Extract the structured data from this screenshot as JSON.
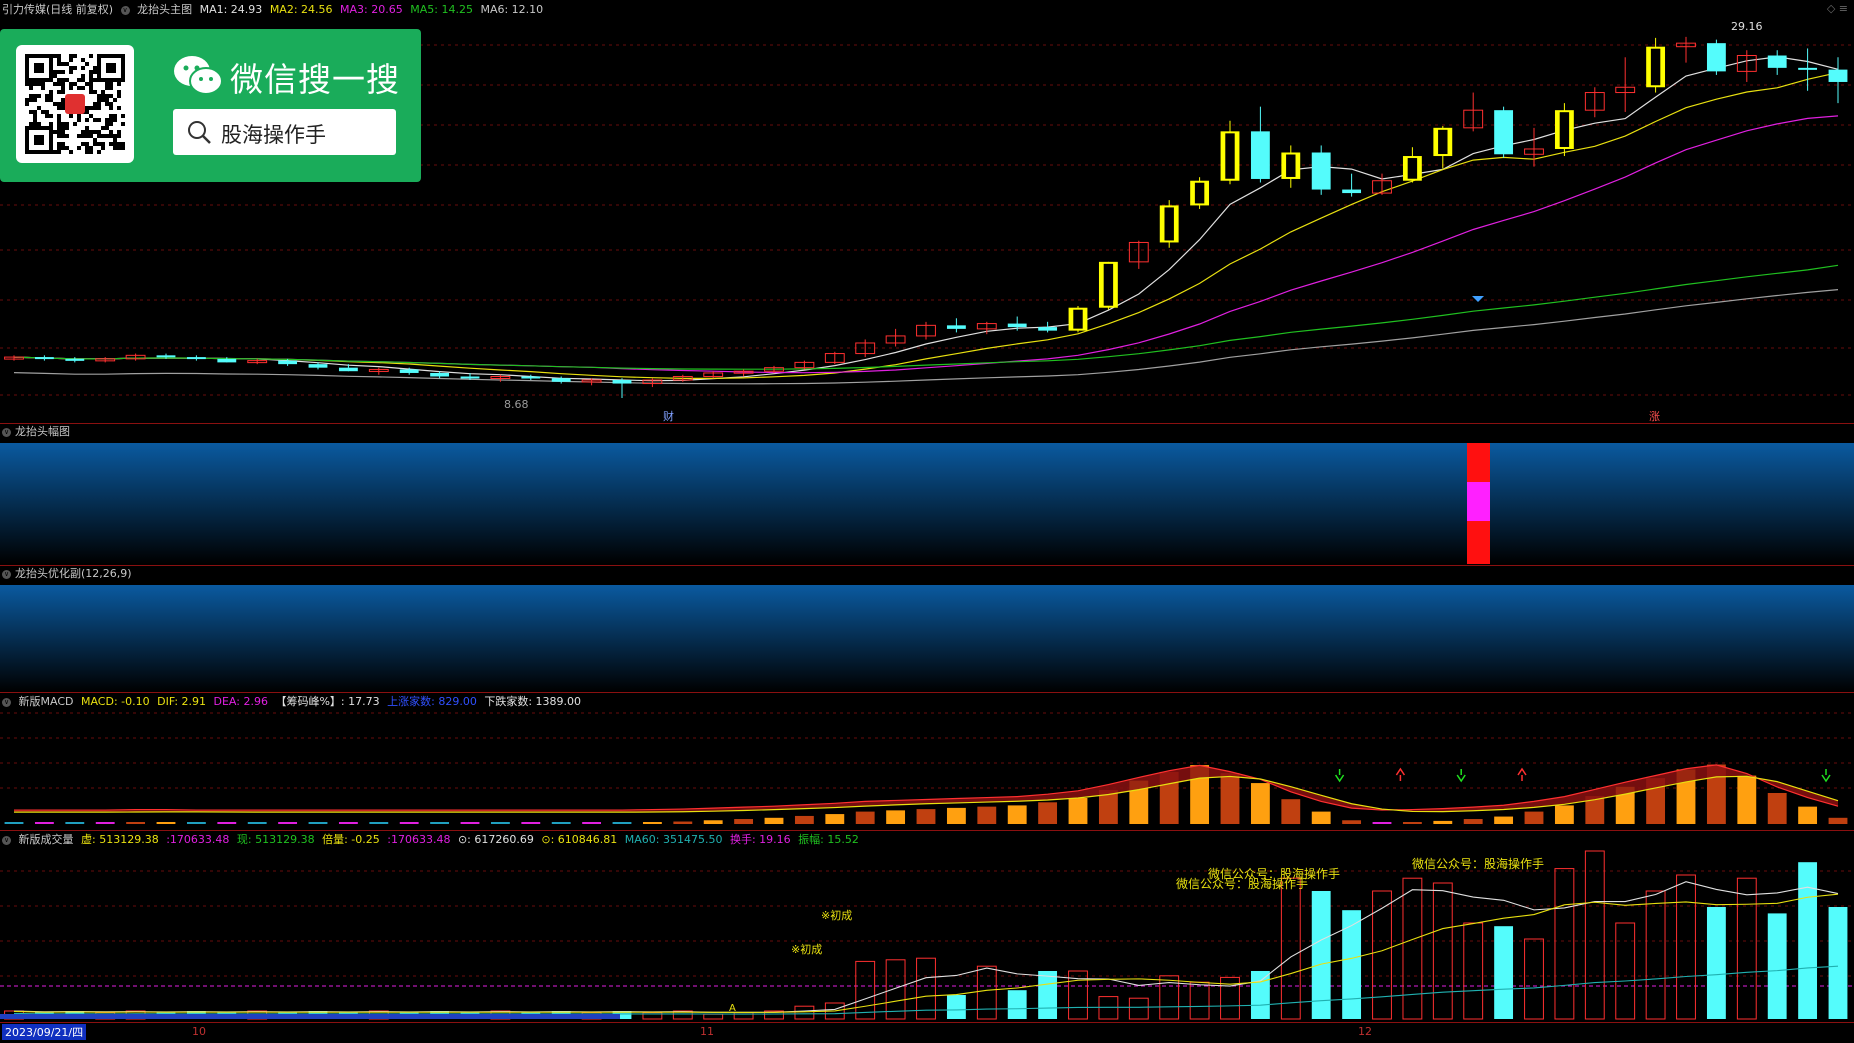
{
  "main_header": {
    "stock": "引力传媒(日线 前复权)",
    "indicator": "龙抬头主图",
    "ma1": "MA1: 24.93",
    "ma2": "MA2: 24.56",
    "ma3": "MA3: 20.65",
    "ma5": "MA5: 14.25",
    "ma6": "MA6: 12.10"
  },
  "main_annotations": {
    "high_price": "29.16",
    "low_price": "8.68",
    "marker_cai": "财",
    "marker_zhang": "涨"
  },
  "wechat_ad": {
    "title": "微信搜一搜",
    "search_text": "股海操作手"
  },
  "panel2_header": "龙抬头幅图",
  "panel3_header": "龙抬头优化副(12,26,9)",
  "macd_header": {
    "name": "新版MACD",
    "macd": "MACD: -0.10",
    "dif": "DIF: 2.91",
    "dea": "DEA: 2.96",
    "chip": "【筹码峰%】: 17.73",
    "up_count": "上涨家数: 829.00",
    "down_count": "下跌家数: 1389.00"
  },
  "volume_header": {
    "name": "新版成交量",
    "xu": "虚: 513129.38",
    "xu2": ":170633.48",
    "xian": "现: 513129.38",
    "beiliang": "倍量: -0.25",
    "beiliang2": ":170633.48",
    "v1": "⊙: 617260.69",
    "v2": "⊙: 610846.81",
    "ma60": "MA60: 351475.50",
    "huanshou": "换手: 19.16",
    "zhenfu": "振幅: 15.52"
  },
  "volume_annotations": {
    "chucheng1": "※初成",
    "chucheng2": "※初成",
    "a_mark": "A",
    "gzh1": "微信公众号：股海操作手",
    "gzh2": "微信公众号：股海操作手",
    "gzh3": "微信公众号：股海操作手"
  },
  "x_axis": {
    "date": "2023/09/21/四",
    "m10": "10",
    "m11": "11",
    "m12": "12"
  },
  "colors": {
    "up": "#ff3030",
    "down": "#54fcfc",
    "ma1": "#e0e0e0",
    "ma2": "#e8e010",
    "ma3": "#e020e0",
    "ma5": "#20c020",
    "ma6": "#a0a0a0",
    "grid": "#8a1010"
  },
  "chart_data": {
    "type": "candlestick",
    "series_count": 61,
    "ohlc": [
      [
        10.9,
        11.1,
        10.8,
        11.0
      ],
      [
        11.0,
        11.1,
        10.8,
        10.9
      ],
      [
        10.9,
        11.0,
        10.7,
        10.8
      ],
      [
        10.8,
        11.0,
        10.7,
        10.9
      ],
      [
        10.9,
        11.2,
        10.8,
        11.1
      ],
      [
        11.1,
        11.2,
        10.9,
        11.0
      ],
      [
        11.0,
        11.1,
        10.8,
        10.9
      ],
      [
        10.9,
        11.0,
        10.7,
        10.7
      ],
      [
        10.7,
        10.9,
        10.6,
        10.8
      ],
      [
        10.8,
        10.9,
        10.5,
        10.6
      ],
      [
        10.6,
        10.7,
        10.3,
        10.4
      ],
      [
        10.4,
        10.6,
        10.2,
        10.2
      ],
      [
        10.2,
        10.4,
        10.0,
        10.3
      ],
      [
        10.3,
        10.4,
        10.0,
        10.1
      ],
      [
        10.1,
        10.2,
        9.8,
        9.9
      ],
      [
        9.9,
        10.1,
        9.7,
        9.8
      ],
      [
        9.8,
        10.0,
        9.6,
        9.9
      ],
      [
        9.9,
        10.0,
        9.7,
        9.8
      ],
      [
        9.8,
        9.9,
        9.5,
        9.6
      ],
      [
        9.6,
        9.8,
        9.4,
        9.7
      ],
      [
        9.7,
        9.8,
        8.68,
        9.5
      ],
      [
        9.5,
        9.8,
        9.3,
        9.7
      ],
      [
        9.7,
        10.0,
        9.6,
        9.9
      ],
      [
        9.9,
        10.2,
        9.8,
        10.1
      ],
      [
        10.1,
        10.3,
        9.9,
        10.2
      ],
      [
        10.2,
        10.5,
        10.1,
        10.4
      ],
      [
        10.4,
        10.8,
        10.3,
        10.7
      ],
      [
        10.7,
        11.3,
        10.6,
        11.2
      ],
      [
        11.2,
        12.0,
        11.0,
        11.8
      ],
      [
        11.8,
        12.6,
        11.6,
        12.2
      ],
      [
        12.2,
        13.0,
        12.0,
        12.8
      ],
      [
        12.8,
        13.2,
        12.4,
        12.6
      ],
      [
        12.6,
        13.0,
        12.3,
        12.9
      ],
      [
        12.9,
        13.3,
        12.5,
        12.7
      ],
      [
        12.7,
        13.0,
        12.4,
        12.5
      ],
      [
        12.5,
        13.9,
        12.4,
        13.8
      ],
      [
        13.8,
        16.4,
        13.7,
        16.4
      ],
      [
        16.4,
        17.6,
        16.0,
        17.5
      ],
      [
        17.5,
        19.9,
        17.2,
        19.6
      ],
      [
        19.6,
        21.2,
        19.4,
        21.0
      ],
      [
        21.0,
        24.4,
        20.8,
        23.8
      ],
      [
        23.8,
        25.2,
        20.9,
        21.1
      ],
      [
        21.1,
        23.0,
        20.6,
        22.6
      ],
      [
        22.6,
        23.0,
        20.2,
        20.5
      ],
      [
        20.5,
        21.4,
        20.1,
        20.3
      ],
      [
        20.3,
        21.4,
        20.2,
        21.0
      ],
      [
        21.0,
        22.9,
        20.9,
        22.4
      ],
      [
        22.4,
        24.1,
        21.7,
        24.0
      ],
      [
        24.0,
        26.0,
        23.8,
        25.0
      ],
      [
        25.0,
        25.2,
        22.3,
        22.5
      ],
      [
        22.5,
        24.0,
        21.8,
        22.8
      ],
      [
        22.8,
        25.4,
        22.4,
        25.0
      ],
      [
        25.0,
        26.3,
        24.6,
        26.0
      ],
      [
        26.0,
        28.0,
        24.9,
        26.3
      ],
      [
        26.3,
        29.1,
        26.0,
        28.6
      ],
      [
        28.6,
        29.16,
        27.7,
        28.8
      ],
      [
        28.8,
        29.0,
        27.0,
        27.2
      ],
      [
        27.2,
        28.4,
        26.6,
        28.1
      ],
      [
        28.1,
        28.4,
        27.0,
        27.4
      ],
      [
        27.4,
        28.5,
        26.1,
        27.3
      ],
      [
        27.3,
        28.0,
        25.4,
        26.6
      ]
    ],
    "volume": [
      5,
      4,
      5,
      4,
      5,
      4,
      5,
      4,
      5,
      4,
      5,
      4,
      5,
      4,
      5,
      4,
      5,
      4,
      5,
      4,
      5,
      4,
      5,
      3,
      4,
      5,
      8,
      10,
      36,
      37,
      38,
      15,
      33,
      18,
      30,
      30,
      14,
      13,
      27,
      23,
      26,
      30,
      88,
      80,
      68,
      80,
      88,
      85,
      60,
      58,
      50,
      94,
      105,
      60,
      80,
      90,
      70,
      88,
      66,
      98,
      70
    ],
    "macd_hist": [
      0.02,
      0.02,
      0.02,
      0.02,
      0.03,
      0.03,
      0.02,
      0.02,
      0.02,
      0.02,
      0.02,
      0.02,
      0.02,
      0.02,
      0.02,
      0.02,
      0.02,
      0.02,
      0.02,
      0.02,
      0.02,
      0.03,
      0.04,
      0.06,
      0.08,
      0.1,
      0.13,
      0.16,
      0.2,
      0.22,
      0.24,
      0.26,
      0.28,
      0.3,
      0.35,
      0.42,
      0.55,
      0.7,
      0.84,
      0.95,
      0.82,
      0.66,
      0.4,
      0.2,
      0.06,
      0.02,
      0.03,
      0.05,
      0.08,
      0.12,
      0.2,
      0.3,
      0.45,
      0.6,
      0.74,
      0.88,
      0.96,
      0.78,
      0.5,
      0.28,
      0.1
    ]
  }
}
